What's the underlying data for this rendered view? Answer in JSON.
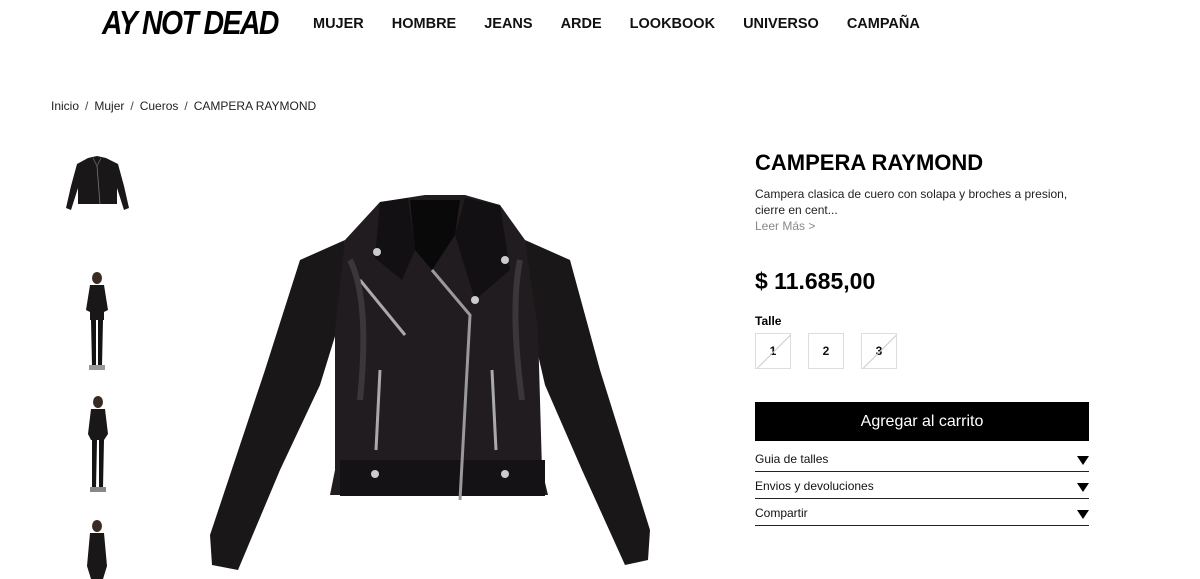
{
  "brand": {
    "logo_text": "AY NOT DEAD"
  },
  "nav": {
    "items": [
      "MUJER",
      "HOMBRE",
      "JEANS",
      "ARDE",
      "LOOKBOOK",
      "UNIVERSO",
      "CAMPAÑA"
    ]
  },
  "breadcrumb": [
    "Inicio",
    "Mujer",
    "Cueros",
    "CAMPERA RAYMOND"
  ],
  "product": {
    "title": "CAMPERA RAYMOND",
    "description": "Campera clasica de cuero con solapa y broches a presion, cierre en cent...",
    "read_more": "Leer Más >",
    "price": "$ 11.685,00",
    "size_label": "Talle",
    "sizes": [
      {
        "label": "1",
        "available": false
      },
      {
        "label": "2",
        "available": true
      },
      {
        "label": "3",
        "available": false
      }
    ],
    "add_to_cart": "Agregar al carrito"
  },
  "accordion": [
    "Guia de talles",
    "Envios y devoluciones",
    "Compartir"
  ],
  "thumbnails": [
    "jacket-front",
    "model-full-front",
    "model-full-side",
    "model-partial"
  ],
  "colors": {
    "jacket": "#1a1719",
    "button_bg": "#000000",
    "text": "#111111"
  }
}
